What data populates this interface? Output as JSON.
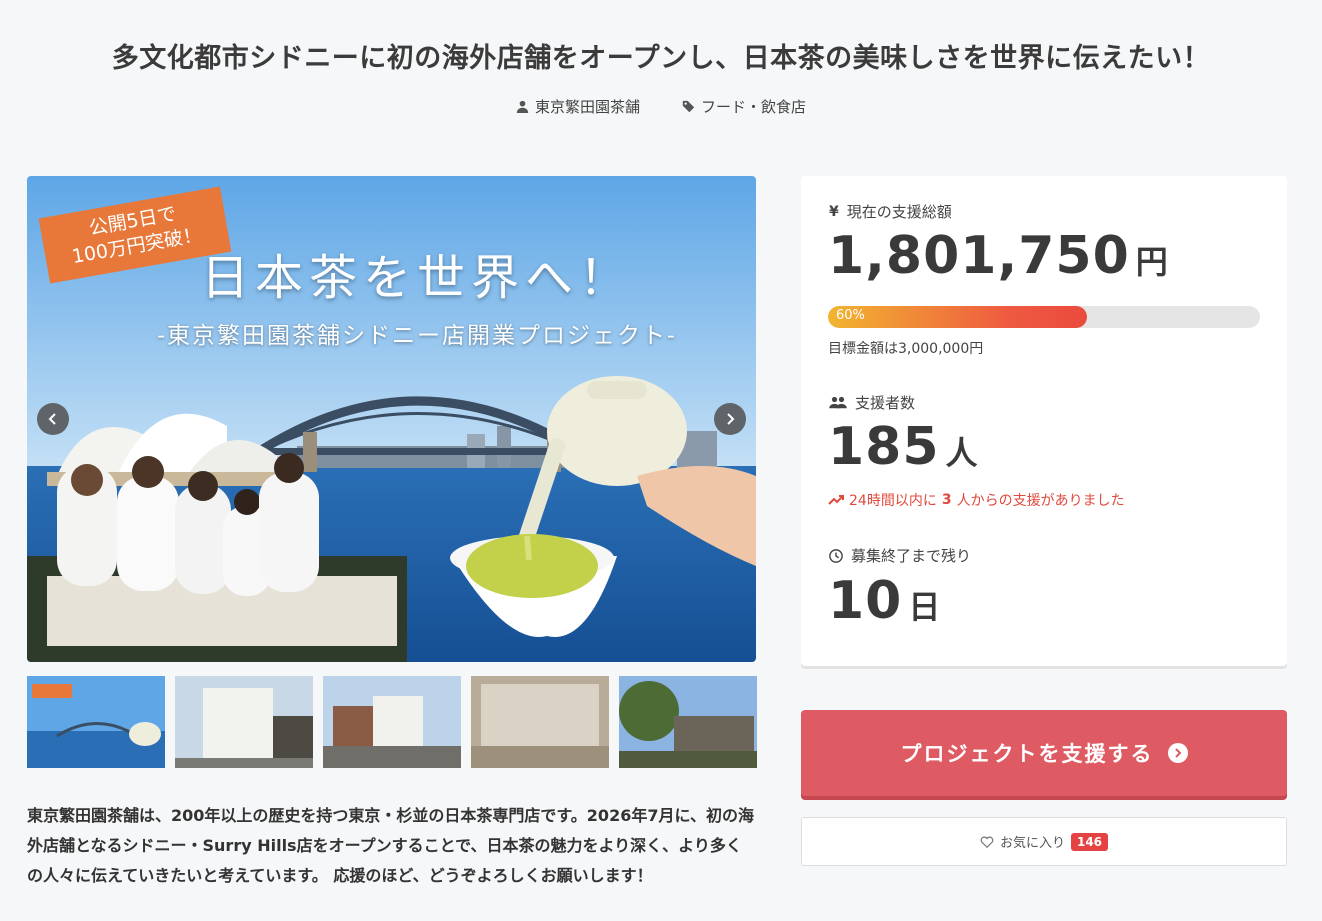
{
  "header": {
    "title": "多文化都市シドニーに初の海外店舗をオープンし、日本茶の美味しさを世界に伝えたい！",
    "owner": "東京繁田園茶舗",
    "category": "フード・飲食店"
  },
  "hero": {
    "badge": "公開5日で\n100万円突破！",
    "headline": "日本茶を世界へ！",
    "subheadline": "-東京繁田園茶舗シドニー店開業プロジェクト-"
  },
  "description": "東京繁田園茶舗は、200年以上の歴史を持つ東京・杉並の日本茶専門店です。2026年7月に、初の海外店舗となるシドニー・Surry Hills店をオープンすることで、日本茶の魅力をより深く、より多くの人々に伝えていきたいと考えています。 応援のほど、どうぞよろしくお願いします！",
  "stats": {
    "amount_label": "現在の支援総額",
    "amount_icon": "yen-icon",
    "amount": "1,801,750",
    "amount_unit": "円",
    "progress_text": "60%",
    "progress_value": 0.6,
    "goal": "目標金額は3,000,000円",
    "supporters_label": "支援者数",
    "supporters": "185",
    "supporters_unit": "人",
    "recent_pre": "24時間以内に",
    "recent_num": "3",
    "recent_post": "人からの支援がありました",
    "remaining_label": "募集終了まで残り",
    "remaining": "10",
    "remaining_unit": "日"
  },
  "actions": {
    "support": "プロジェクトを支援する",
    "favorite": "お気に入り",
    "favorite_count": "146"
  },
  "colors": {
    "accent": "#df5b63",
    "progress_start": "#f2b530",
    "progress_end": "#ea4a3e",
    "trend": "#e0493c"
  }
}
